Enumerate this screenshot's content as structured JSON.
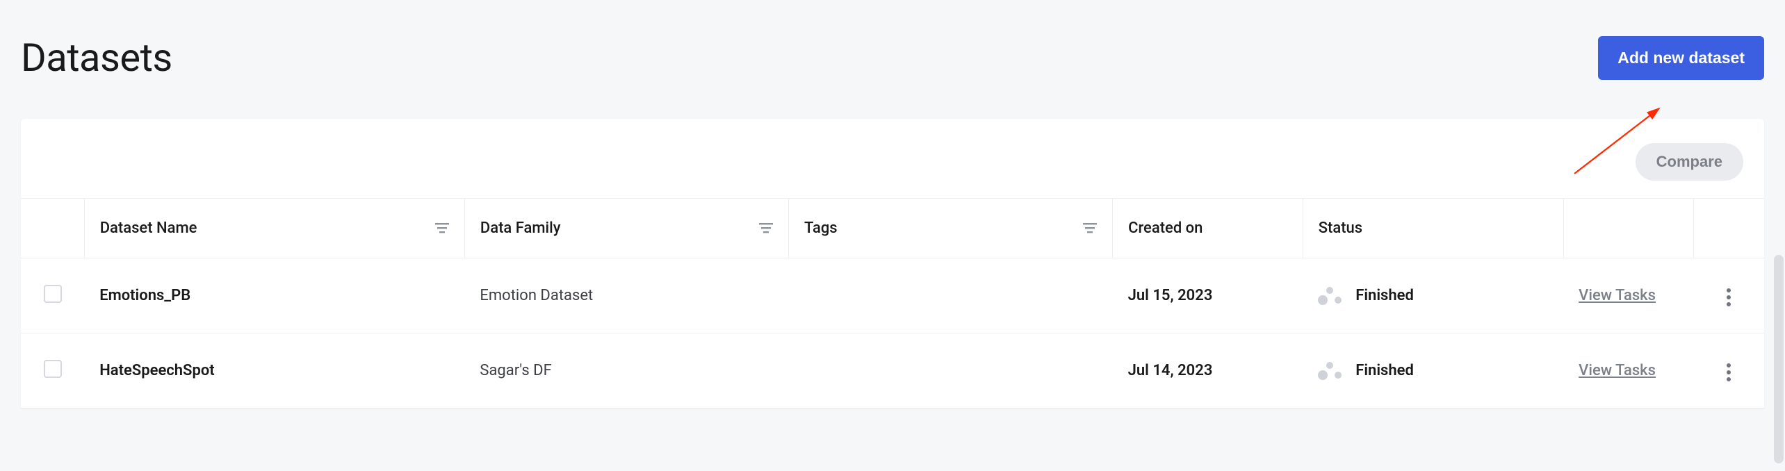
{
  "header": {
    "title": "Datasets",
    "add_button": "Add new dataset"
  },
  "toolbar": {
    "compare": "Compare"
  },
  "columns": {
    "name": "Dataset Name",
    "family": "Data Family",
    "tags": "Tags",
    "created": "Created on",
    "status": "Status"
  },
  "actions": {
    "view_tasks": "View Tasks"
  },
  "rows": [
    {
      "name": "Emotions_PB",
      "family": "Emotion Dataset",
      "tags": "",
      "created": "Jul 15, 2023",
      "status": "Finished"
    },
    {
      "name": "HateSpeechSpot",
      "family": "Sagar's DF",
      "tags": "",
      "created": "Jul 14, 2023",
      "status": "Finished"
    }
  ]
}
